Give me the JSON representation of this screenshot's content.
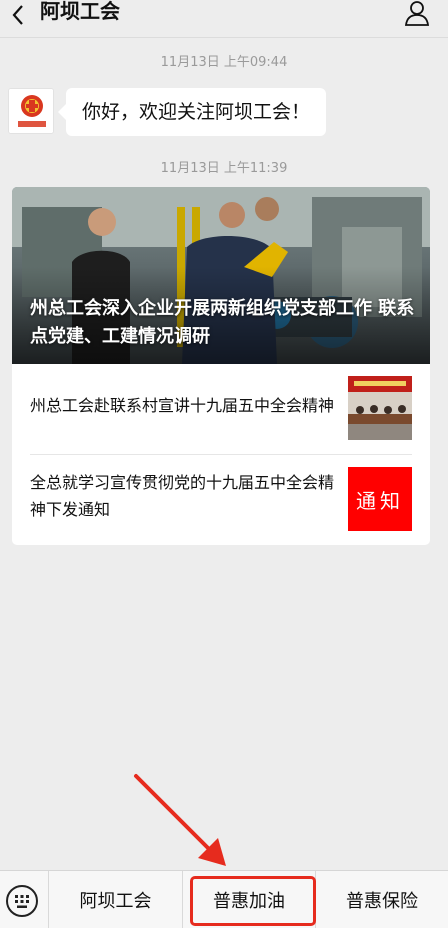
{
  "header": {
    "title": "阿坝工会",
    "back_icon": "chevron-left-icon",
    "profile_icon": "user-icon"
  },
  "messages": [
    {
      "timestamp": "11月13日 上午09:44",
      "text": "你好，欢迎关注阿坝工会！"
    },
    {
      "timestamp": "11月13日 上午11:39"
    }
  ],
  "avatar": {
    "label": "阿坝工会"
  },
  "article_card": {
    "main_title": "州总工会深入企业开展两新组织党支部工作 联系点党建、工建情况调研",
    "items": [
      {
        "title": "州总工会赴联系村宣讲十九届五中全会精神"
      },
      {
        "title": "全总就学习宣传贯彻党的十九届五中全会精神下发通知",
        "thumb_text": "通知"
      }
    ]
  },
  "bottom_menu": {
    "keyboard_icon": "keyboard-icon",
    "tabs": [
      "阿坝工会",
      "普惠加油",
      "普惠保险"
    ]
  },
  "colors": {
    "highlight": "#e62b1e",
    "notice_bg": "#ff0000",
    "background": "#ededed"
  }
}
